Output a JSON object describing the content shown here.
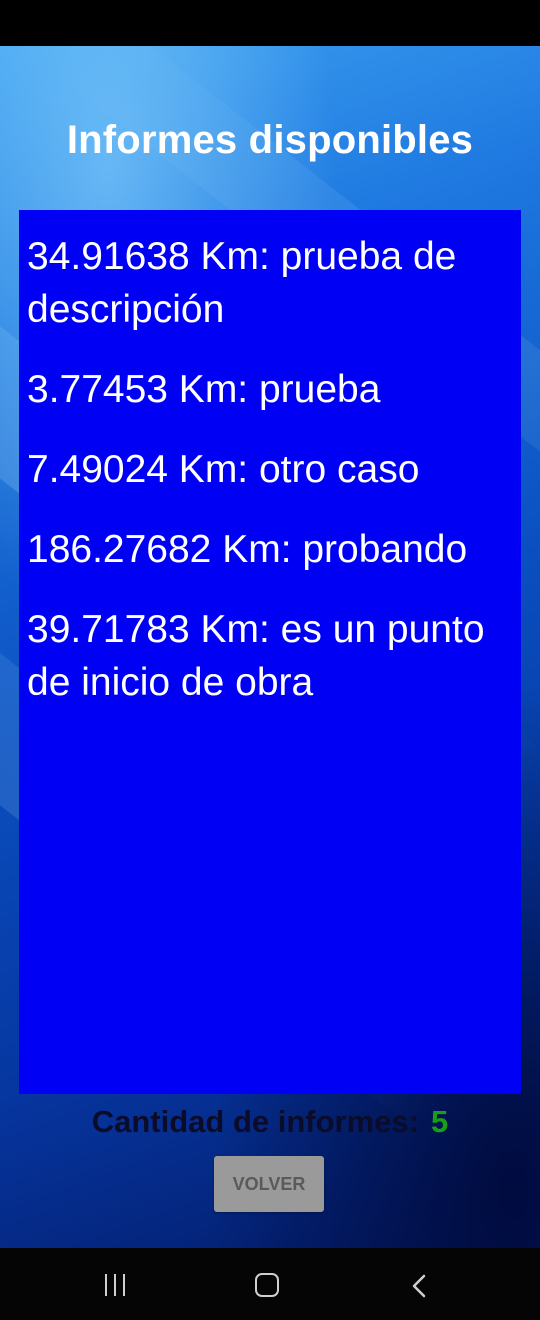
{
  "header": {
    "title": "Informes disponibles"
  },
  "reports": [
    {
      "text": "34.91638 Km:  prueba de descripción"
    },
    {
      "text": "3.77453 Km:  prueba"
    },
    {
      "text": "7.49024 Km:  otro caso"
    },
    {
      "text": "186.27682 Km:  probando"
    },
    {
      "text": "39.71783 Km:  es un punto de inicio de obra"
    }
  ],
  "summary": {
    "count_label": "Cantidad de informes:",
    "count_value": "5"
  },
  "actions": {
    "back_label": "VOLVER"
  },
  "nav": {
    "recent_icon": "recent-apps-icon",
    "home_icon": "home-icon",
    "back_icon": "back-icon"
  },
  "colors": {
    "list_background": "#0000f5",
    "count_value": "#16a016",
    "button_background": "#9a9a9a"
  }
}
